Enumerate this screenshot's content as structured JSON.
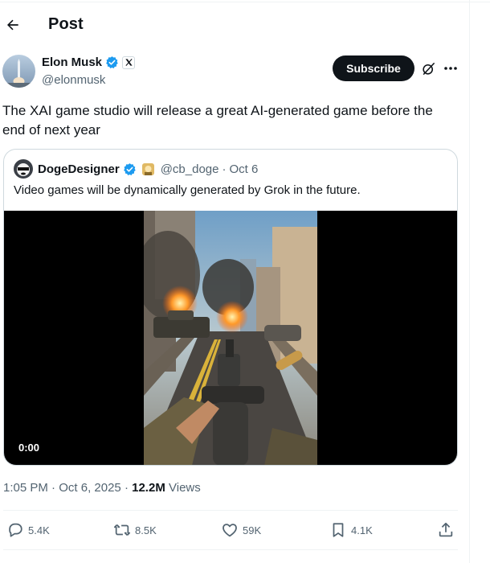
{
  "header": {
    "title": "Post"
  },
  "author": {
    "name": "Elon Musk",
    "handle": "@elonmusk",
    "avatar_icon": "rocket-launch-avatar",
    "verified_color": "#1d9bf0"
  },
  "actions_top": {
    "subscribe_label": "Subscribe"
  },
  "post": {
    "text": "The XAI game studio will release a great AI-generated game before the end of next year"
  },
  "quote": {
    "name": "DogeDesigner",
    "handle": "@cb_doge",
    "separator": "·",
    "date": "Oct 6",
    "text": "Video games will be dynamically generated by Grok in the future.",
    "video_time": "0:00"
  },
  "meta": {
    "time": "1:05 PM",
    "separator": "·",
    "date": "Oct 6, 2025",
    "views_count": "12.2M",
    "views_label": "Views"
  },
  "engagement": {
    "replies": "5.4K",
    "reposts": "8.5K",
    "likes": "59K",
    "bookmarks": "4.1K"
  },
  "colors": {
    "text_primary": "#0f1419",
    "text_secondary": "#536471",
    "accent_blue": "#1d9bf0",
    "button_dark": "#0f1419"
  }
}
